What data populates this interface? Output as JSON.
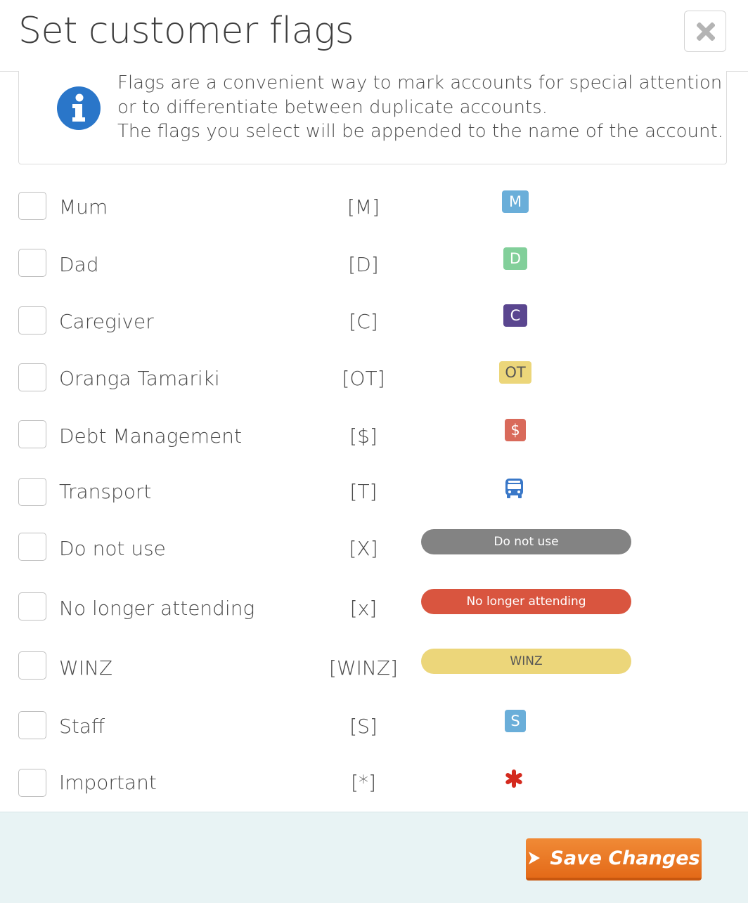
{
  "dialog": {
    "title": "Set customer flags",
    "close_icon": "close-x-icon"
  },
  "info": {
    "icon": "info-circle-icon",
    "lines": [
      "Flags are a convenient way to mark accounts for special attention",
      "or to differentiate between duplicate accounts.",
      "The flags you select will be appended to the name of the account."
    ]
  },
  "flags": [
    {
      "label": "Mum",
      "code": "[M]",
      "badge": "M",
      "color": "#6aaed9",
      "checked": false
    },
    {
      "label": "Dad",
      "code": "[D]",
      "badge": "D",
      "color": "#82cf9a",
      "checked": false
    },
    {
      "label": "Caregiver",
      "code": "[C]",
      "badge": "C",
      "color": "#5a468f",
      "checked": false
    },
    {
      "label": "Oranga Tamariki",
      "code": "[OT]",
      "badge": "OT",
      "color": "#ecd67a",
      "checked": false
    },
    {
      "label": "Debt Management",
      "code": "[$]",
      "badge": "$",
      "color": "#d96a5b",
      "checked": false
    },
    {
      "label": "Transport",
      "code": "[T]",
      "badge_icon": "bus-icon",
      "color": "#3a78c8",
      "checked": false
    },
    {
      "label": "Do not use",
      "code": "[X]",
      "badge": "Do not use",
      "color": "#838383",
      "checked": false
    },
    {
      "label": "No longer attending",
      "code": "[x]",
      "badge": "No longer attending",
      "color": "#d9553f",
      "checked": false
    },
    {
      "label": "WINZ",
      "code": "[WINZ]",
      "badge": "WINZ",
      "color": "#ecd67a",
      "checked": false
    },
    {
      "label": "Staff",
      "code": "[S]",
      "badge": "S",
      "color": "#6aaed9",
      "checked": false
    },
    {
      "label": "Important",
      "code": "[*]",
      "badge_icon": "asterisk-icon",
      "color": "#d42a1e",
      "checked": false
    }
  ],
  "footer": {
    "save_label": "Save Changes",
    "save_icon": "chevron-right-icon",
    "save_color": "#e87421"
  }
}
